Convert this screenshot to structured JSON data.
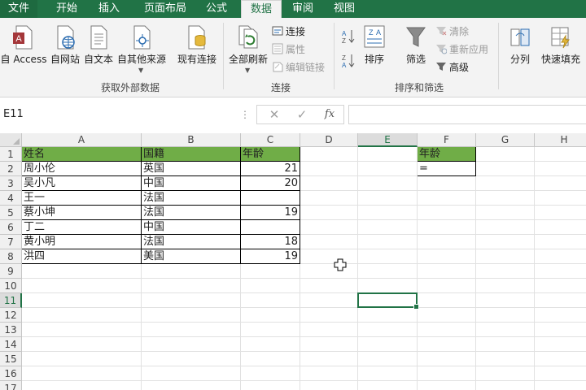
{
  "tabs": [
    "文件",
    "开始",
    "插入",
    "页面布局",
    "公式",
    "数据",
    "审阅",
    "视图"
  ],
  "active_tab": "数据",
  "ribbon": {
    "get_external": {
      "buttons": [
        "自 Access",
        "自网站",
        "自文本",
        "自其他来源",
        "现有连接"
      ],
      "label": "获取外部数据"
    },
    "connections": {
      "refresh_all": "全部刷新",
      "small": [
        "连接",
        "属性",
        "编辑链接"
      ],
      "label": "连接"
    },
    "sort_filter": {
      "sort": "排序",
      "filter": "筛选",
      "small": [
        "清除",
        "重新应用",
        "高级"
      ],
      "label": "排序和筛选"
    },
    "tools": {
      "split": "分列",
      "flash_fill": "快速填充"
    }
  },
  "formula_bar": {
    "name_box": "E11",
    "formula": "",
    "fx": "fx"
  },
  "columns": [
    "A",
    "B",
    "C",
    "D",
    "E",
    "F",
    "G",
    "H"
  ],
  "selected_column": "E",
  "rows": [
    "1",
    "2",
    "3",
    "4",
    "5",
    "6",
    "7",
    "8",
    "9",
    "10",
    "11",
    "12",
    "13",
    "14",
    "15",
    "16",
    "17"
  ],
  "selected_row": "11",
  "table": {
    "headers": [
      "姓名",
      "国籍",
      "年龄"
    ],
    "rows": [
      [
        "周小伦",
        "英国",
        "21"
      ],
      [
        "吴小凡",
        "中国",
        "20"
      ],
      [
        "王一",
        "法国",
        ""
      ],
      [
        "蔡小坤",
        "法国",
        "19"
      ],
      [
        "丁二",
        "中国",
        ""
      ],
      [
        "黄小明",
        "法国",
        "18"
      ],
      [
        "洪四",
        "美国",
        "19"
      ]
    ]
  },
  "f_column": {
    "header": "年龄",
    "entry": "="
  },
  "active_cell": "E11",
  "colors": {
    "accent": "#217346",
    "header_fill": "#70ad47"
  }
}
